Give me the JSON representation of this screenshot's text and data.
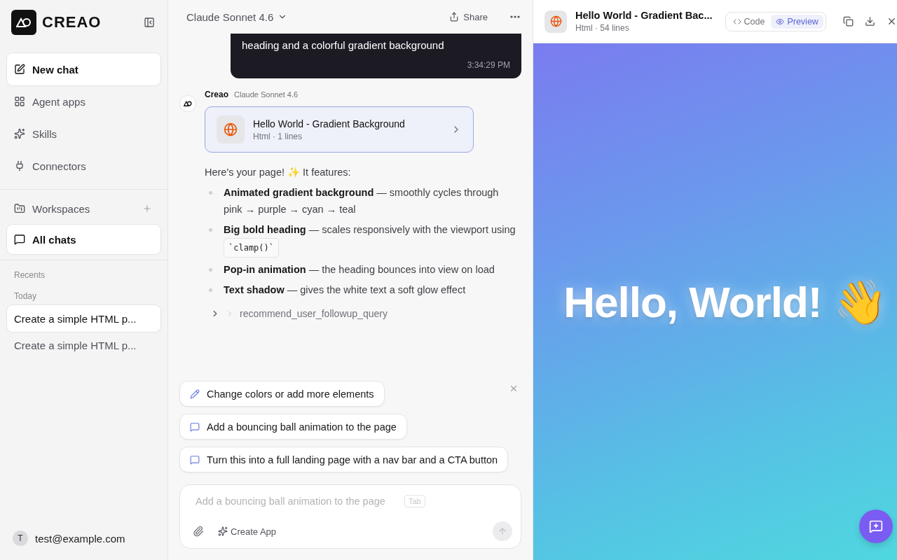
{
  "sidebar": {
    "brand": "CREAO",
    "nav": [
      {
        "label": "New chat",
        "kind": "new",
        "selected": true
      },
      {
        "label": "Agent apps",
        "kind": "apps",
        "selected": false
      },
      {
        "label": "Skills",
        "kind": "skills",
        "selected": false
      },
      {
        "label": "Connectors",
        "kind": "plug",
        "selected": false
      }
    ],
    "workspaces": {
      "label": "Workspaces"
    },
    "all_chats": {
      "label": "All chats",
      "selected": true
    },
    "recents_label": "Recents",
    "groups": [
      {
        "label": "Today",
        "chats": [
          {
            "title": "Create a simple HTML p...",
            "selected": true
          },
          {
            "title": "Create a simple HTML p...",
            "selected": false
          }
        ]
      }
    ],
    "user": {
      "initial": "T",
      "email": "test@example.com"
    }
  },
  "chat": {
    "model": "Claude Sonnet 4.6",
    "share": "Share",
    "user_message": {
      "text": "heading and a colorful gradient background",
      "time": "3:34:29 PM"
    },
    "reply": {
      "author": "Creao",
      "model": "Claude Sonnet 4.6",
      "artifact": {
        "title": "Hello World - Gradient Background",
        "type": "Html",
        "separator": "·",
        "lines": "1 lines"
      },
      "intro": "Here's your page! ✨ It features:",
      "points": [
        {
          "text": "**Animated gradient background** — smoothly cycles through pink → purple → cyan → teal"
        },
        {
          "text": "**Big bold heading** — scales responsively with the viewport using",
          "code": "`clamp()`"
        },
        {
          "text": "**Pop-in animation** — the heading bounces into view on load"
        },
        {
          "text": "**Text shadow** — gives the white text a soft glow effect"
        }
      ],
      "tool_call": {
        "name": "recommend_user_followup_query",
        "expanded": false
      }
    },
    "suggestions": [
      {
        "text": "Change colors or add more elements",
        "kind": "edit"
      },
      {
        "text": "Add a bouncing ball animation to the page",
        "kind": "prompt"
      },
      {
        "text": "Turn this into a full landing page with a nav bar and a CTA button",
        "kind": "prompt"
      }
    ],
    "composer": {
      "placeholder": "Add a bouncing ball animation to the page",
      "hint_key": "Tab",
      "create_app": "Create App"
    }
  },
  "preview": {
    "title": "Hello World - Gradient Bac...",
    "type": "Html",
    "separator": "·",
    "lines": "54 lines",
    "tabs": [
      {
        "label": "Code",
        "kind": "code",
        "selected": false
      },
      {
        "label": "Preview",
        "kind": "eye",
        "selected": true
      }
    ],
    "heading": "Hello, World! 👋"
  }
}
